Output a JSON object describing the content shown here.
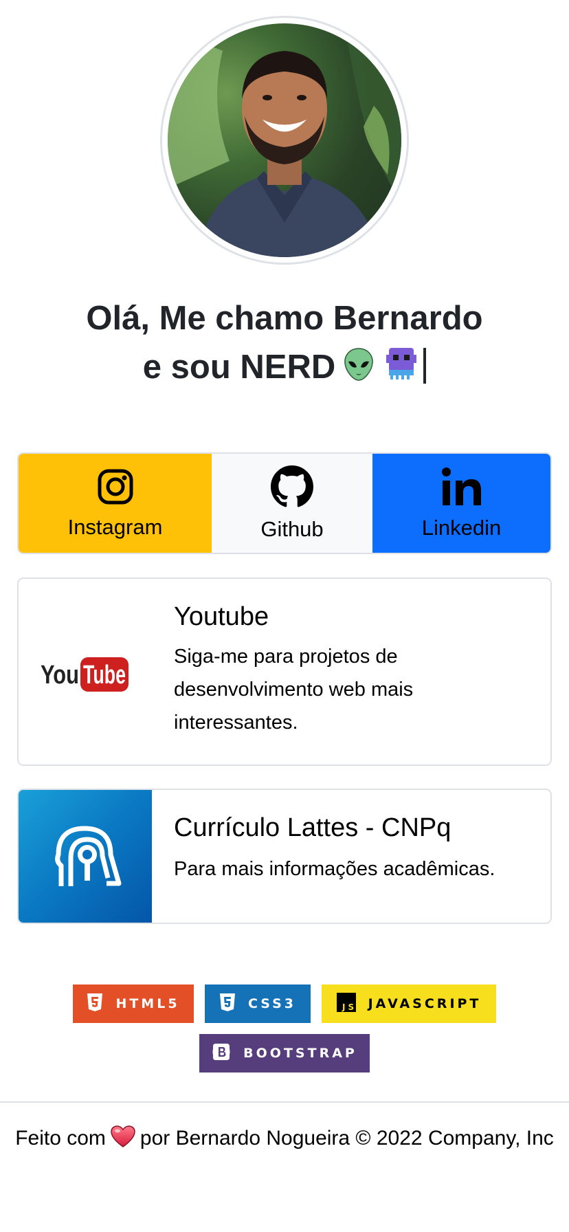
{
  "profile": {
    "greeting_line1": "Olá, Me chamo Bernardo",
    "greeting_line2": "e sou NERD",
    "emojis": [
      "alien-icon",
      "alien-monster-icon"
    ]
  },
  "social": [
    {
      "label": "Instagram",
      "icon": "instagram-icon",
      "color": "#ffc107"
    },
    {
      "label": "Github",
      "icon": "github-icon",
      "color": "#f8f9fa"
    },
    {
      "label": "Linkedin",
      "icon": "linkedin-icon",
      "color": "#0d6efd"
    }
  ],
  "cards": {
    "youtube": {
      "title": "Youtube",
      "text": "Siga-me para projetos de desenvolvimento web mais interessantes.",
      "logo_you": "You",
      "logo_tube": "Tube"
    },
    "lattes": {
      "title": "Currículo Lattes - CNPq",
      "text": "Para mais informações acadêmicas."
    }
  },
  "badges": [
    {
      "label": "HTML5",
      "color": "#e34f26"
    },
    {
      "label": "CSS3",
      "color": "#1572b6"
    },
    {
      "label": "JAVASCRIPT",
      "color": "#f7df1e"
    },
    {
      "label": "BOOTSTRAP",
      "color": "#563d7c"
    }
  ],
  "footer": {
    "prefix": "Feito com",
    "suffix": "por Bernardo Nogueira © 2022 Company, Inc"
  }
}
